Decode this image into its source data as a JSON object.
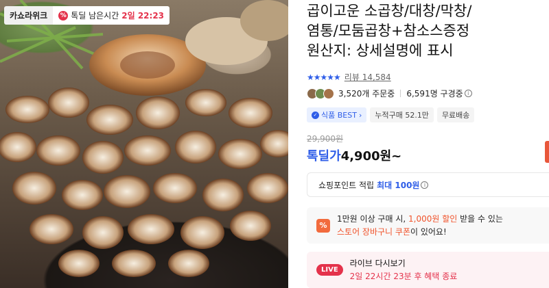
{
  "photo": {
    "brand_badge": "카쇼라위크",
    "deal_icon": "%",
    "deal_label": "톡딜 남은시간",
    "deal_remaining": "2일 22:23"
  },
  "product": {
    "title_line1": "곱이고운 소곱창/대창/막창/",
    "title_line2": "염통/모둠곱창+참소스증정",
    "title_line3": "원산지: 상세설명에 표시",
    "stars": "★★★★★",
    "review_label": "리뷰 14,584",
    "orders": "3,520개 주문중",
    "viewers": "6,591명 구경중",
    "info_icon": "i",
    "tags": [
      {
        "label": "식품 BEST",
        "icon": "circle-check-icon"
      },
      {
        "label": "누적구매 52.1만"
      },
      {
        "label": "무료배송"
      }
    ],
    "original_price": "29,900원",
    "sale_label": "톡딜가",
    "sale_price": "4,900원~"
  },
  "benefits": {
    "point_label": "쇼핑포인트 적립",
    "point_highlight": "최대 100원",
    "coupon_icon": "%",
    "coupon_line1_a": "1만원 이상 구매 시, ",
    "coupon_line1_b": "1,000원 할인",
    "coupon_line1_c": " 받을 수 있는",
    "coupon_line2_a": "스토어 장바구니 쿠폰",
    "coupon_line2_b": "이 있어요!",
    "live_badge": "LIVE",
    "live_title": "라이브 다시보기",
    "live_sub": "2일 22시간 23분 후 혜택 종료"
  },
  "colors": {
    "accent_blue": "#2f5ee8",
    "accent_red": "#e4324b",
    "accent_orange": "#f0532b"
  }
}
